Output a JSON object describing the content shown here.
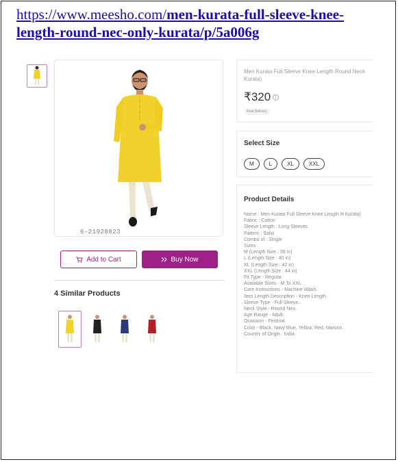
{
  "url": {
    "domain": "https://www.meesho.com/",
    "path": "men-kurata-full-sleeve-knee-length-round-nec-only-kurata/p/5a006g"
  },
  "product": {
    "name": "Men Kurata Full Sleeve Knee Length Round Neck Kurata)",
    "price": "₹320",
    "price_info_icon": "info-icon",
    "delivery_badge": "Free Delivery",
    "sku": "6-21928823"
  },
  "actions": {
    "add_to_cart": "Add to Cart",
    "buy_now": "Buy Now",
    "brand_color": "#9f2089"
  },
  "similar": {
    "title": "4 Similar Products",
    "colors": [
      "#f1d22d",
      "#222222",
      "#2c3a7a",
      "#b11e26"
    ]
  },
  "sizes": {
    "title": "Select Size",
    "options": [
      "M",
      "L",
      "XL",
      "XXL"
    ]
  },
  "details": {
    "title": "Product Details",
    "lines": [
      "Name : Men Kurata Full Sleeve Knee Length R Kurata)",
      "Fabric : Cotton",
      "Sleeve Length : Long Sleeves",
      "Pattern : Solid",
      "Combo of : Single",
      "Sizes :",
      "M (Length Size : 38 in)",
      "L (Length Size : 40 in)",
      "XL (Length Size : 42 in)",
      "XXL (Length Size : 44 in)",
      "Fit Type - Regular.",
      "Available Sizes - M To XXL.",
      "Care Instructions - Machine Wash.",
      "Item Length Description - Knee Length.",
      "Sleeve Type - Full Sleeve.",
      "Neck Style - Round Neo.",
      "Age Range - Adult.",
      "Ocassion - Festival.",
      "Color - Black, Navy Blue, Yellow, Red, Maroon.",
      "Country of Origin : India"
    ]
  }
}
